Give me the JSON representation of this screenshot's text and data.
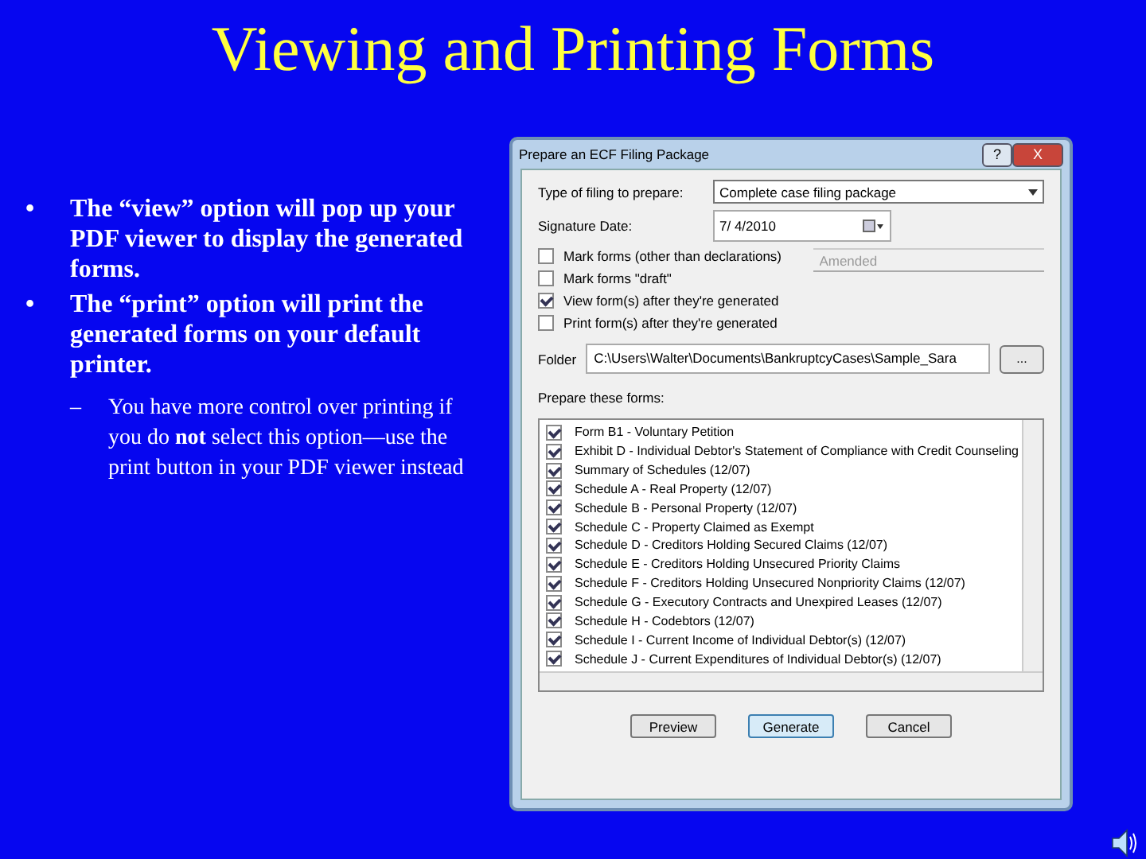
{
  "slide": {
    "title": "Viewing and Printing Forms",
    "bullets": [
      {
        "text": "The “view” option will pop up your PDF viewer to display the generated forms.",
        "marker": "•"
      },
      {
        "text": "The “print” option will print the generated forms on your default printer.",
        "marker": "•"
      }
    ],
    "sub_bullets": [
      {
        "text": "You have more control over printing if you do **not** select this option—use the print button in your PDF viewer instead",
        "marker": "–"
      }
    ]
  },
  "dialog": {
    "title": "Prepare an ECF Filing Package",
    "help_button": "?",
    "close_button": "X",
    "filing_type": {
      "label": "Type of filing to prepare:",
      "value": "Complete case filing package"
    },
    "signature_date": {
      "label": "Signature Date:",
      "value": "7/ 4/2010"
    },
    "options": [
      {
        "label": "Mark forms (other than declarations)",
        "checked": false
      },
      {
        "label": "Mark forms \"draft\"",
        "checked": false
      },
      {
        "label": "View form(s) after they're generated",
        "checked": true
      },
      {
        "label": "Print form(s) after they're generated",
        "checked": false
      }
    ],
    "amended_field": {
      "placeholder": "Amended",
      "disabled": true
    },
    "folder": {
      "label": "Folder",
      "value": "C:\\Users\\Walter\\Documents\\BankruptcyCases\\Sample_Sara",
      "browse": "..."
    },
    "forms_label": "Prepare these forms:",
    "forms": [
      {
        "label": "Form B1 - Voluntary Petition",
        "checked": true
      },
      {
        "label": "Exhibit D - Individual Debtor's Statement of Compliance with Credit Counseling",
        "checked": true
      },
      {
        "label": "Summary of Schedules (12/07)",
        "checked": true
      },
      {
        "label": "Schedule A - Real Property (12/07)",
        "checked": true
      },
      {
        "label": "Schedule B - Personal Property (12/07)",
        "checked": true
      },
      {
        "label": "Schedule C - Property Claimed as Exempt",
        "checked": true
      },
      {
        "label": "Schedule D - Creditors Holding Secured Claims (12/07)",
        "checked": true
      },
      {
        "label": "Schedule E - Creditors Holding Unsecured Priority Claims",
        "checked": true
      },
      {
        "label": "Schedule F - Creditors Holding Unsecured Nonpriority Claims (12/07)",
        "checked": true
      },
      {
        "label": "Schedule G - Executory Contracts and Unexpired Leases (12/07)",
        "checked": true
      },
      {
        "label": "Schedule H - Codebtors (12/07)",
        "checked": true
      },
      {
        "label": "Schedule I - Current Income of Individual Debtor(s) (12/07)",
        "checked": true
      },
      {
        "label": "Schedule J - Current Expenditures of Individual Debtor(s) (12/07)",
        "checked": true
      }
    ],
    "buttons": [
      {
        "label": "Preview",
        "default": false
      },
      {
        "label": "Generate",
        "default": true
      },
      {
        "label": "Cancel",
        "default": false
      }
    ]
  }
}
